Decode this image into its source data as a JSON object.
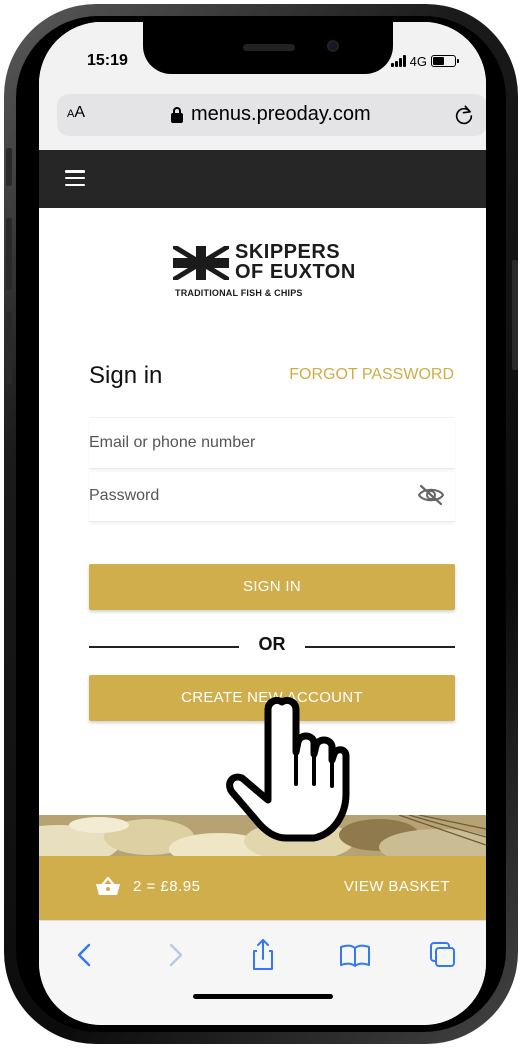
{
  "status_bar": {
    "time": "15:19",
    "network": "4G",
    "battery_level": 0.5
  },
  "browser": {
    "text_size_label_small": "A",
    "text_size_label_large": "A",
    "url": "menus.preoday.com",
    "lock_icon": "lock-icon",
    "reload_icon": "reload-icon"
  },
  "header": {
    "menu_icon": "hamburger-icon",
    "background": "#262626"
  },
  "logo": {
    "line1": "SKIPPERS",
    "line2": "OF EUXTON",
    "tagline": "TRADITIONAL FISH & CHIPS"
  },
  "signin": {
    "title": "Sign in",
    "forgot_password": "FORGOT PASSWORD",
    "email_placeholder": "Email or phone number",
    "password_placeholder": "Password",
    "signin_button": "SIGN IN",
    "or_label": "OR",
    "create_account_button": "CREATE NEW ACCOUNT"
  },
  "basket": {
    "summary": "2 = £8.95",
    "view_basket": "VIEW BASKET"
  },
  "toolbar": {
    "back_icon": "back-arrow-icon",
    "forward_icon": "forward-arrow-icon",
    "share_icon": "share-icon",
    "bookmarks_icon": "bookmarks-icon",
    "tabs_icon": "tabs-icon"
  },
  "colors": {
    "accent_gold": "#d1ae4c",
    "header_dark": "#262626",
    "toolbar_blue": "#3478f6"
  }
}
